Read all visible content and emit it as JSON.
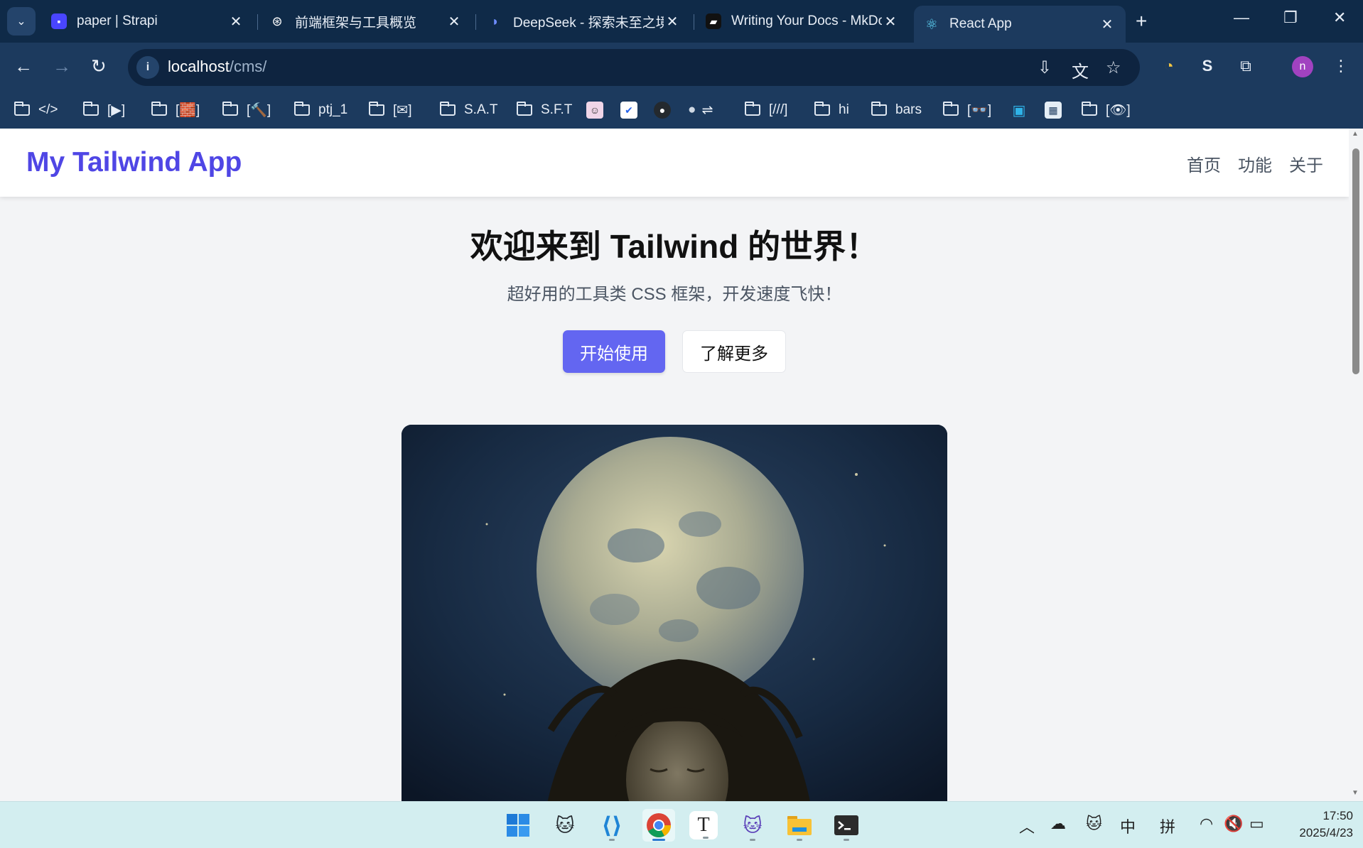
{
  "browser": {
    "tabs": [
      {
        "title": "paper | Strapi",
        "icon": "strapi-icon",
        "active": false
      },
      {
        "title": "前端框架与工具概览",
        "icon": "openai-icon",
        "active": false
      },
      {
        "title": "DeepSeek - 探索未至之境",
        "icon": "deepseek-icon",
        "active": false
      },
      {
        "title": "Writing Your Docs - MkDocs",
        "icon": "book-icon",
        "active": false
      },
      {
        "title": "React App",
        "icon": "react-icon",
        "active": true
      }
    ],
    "address": {
      "host": "localhost",
      "path": "/cms/"
    },
    "profile_initial": "n",
    "bookmarks": [
      {
        "label": "</>",
        "type": "folder"
      },
      {
        "label": "[▶]",
        "type": "folder"
      },
      {
        "label": "[🧱]",
        "type": "folder"
      },
      {
        "label": "[🔨]",
        "type": "folder"
      },
      {
        "label": "ptj_1",
        "type": "folder"
      },
      {
        "label": "[✉]",
        "type": "folder"
      },
      {
        "label": "S.A.T",
        "type": "folder"
      },
      {
        "label": "S.F.T",
        "type": "folder"
      },
      {
        "label": "",
        "type": "image-avatar"
      },
      {
        "label": "",
        "type": "image-checkmark"
      },
      {
        "label": "",
        "type": "image-github"
      },
      {
        "label": "⇌",
        "type": "apple"
      },
      {
        "label": "[///]",
        "type": "folder"
      },
      {
        "label": "hi",
        "type": "folder"
      },
      {
        "label": "bars",
        "type": "folder"
      },
      {
        "label": "[👓]",
        "type": "folder"
      },
      {
        "label": "",
        "type": "image-bilibili"
      },
      {
        "label": "",
        "type": "image-notes"
      },
      {
        "label": "[👁]",
        "type": "folder"
      }
    ]
  },
  "page": {
    "brand": "My Tailwind App",
    "nav": [
      "首页",
      "功能",
      "关于"
    ],
    "hero_title": "欢迎来到 Tailwind 的世界！",
    "hero_subtitle": "超好用的工具类 CSS 框架，开发速度飞快！",
    "primary_button": "开始使用",
    "secondary_button": "了解更多"
  },
  "taskbar": {
    "apps": [
      "windows-start-icon",
      "github-cat-icon",
      "vscode-icon",
      "chrome-icon",
      "typora-icon",
      "github-desktop-icon",
      "file-explorer-icon",
      "terminal-icon"
    ],
    "tray": {
      "ime_lang": "中",
      "ime_mode": "拼"
    },
    "time": "17:50",
    "date": "2025/4/23"
  },
  "colors": {
    "brand": "#4f46e5",
    "primary_button": "#6366f1",
    "chrome_bg": "#1c3a5e",
    "tabstrip_bg": "#0f2a48",
    "taskbar_bg": "#d3eef0"
  }
}
